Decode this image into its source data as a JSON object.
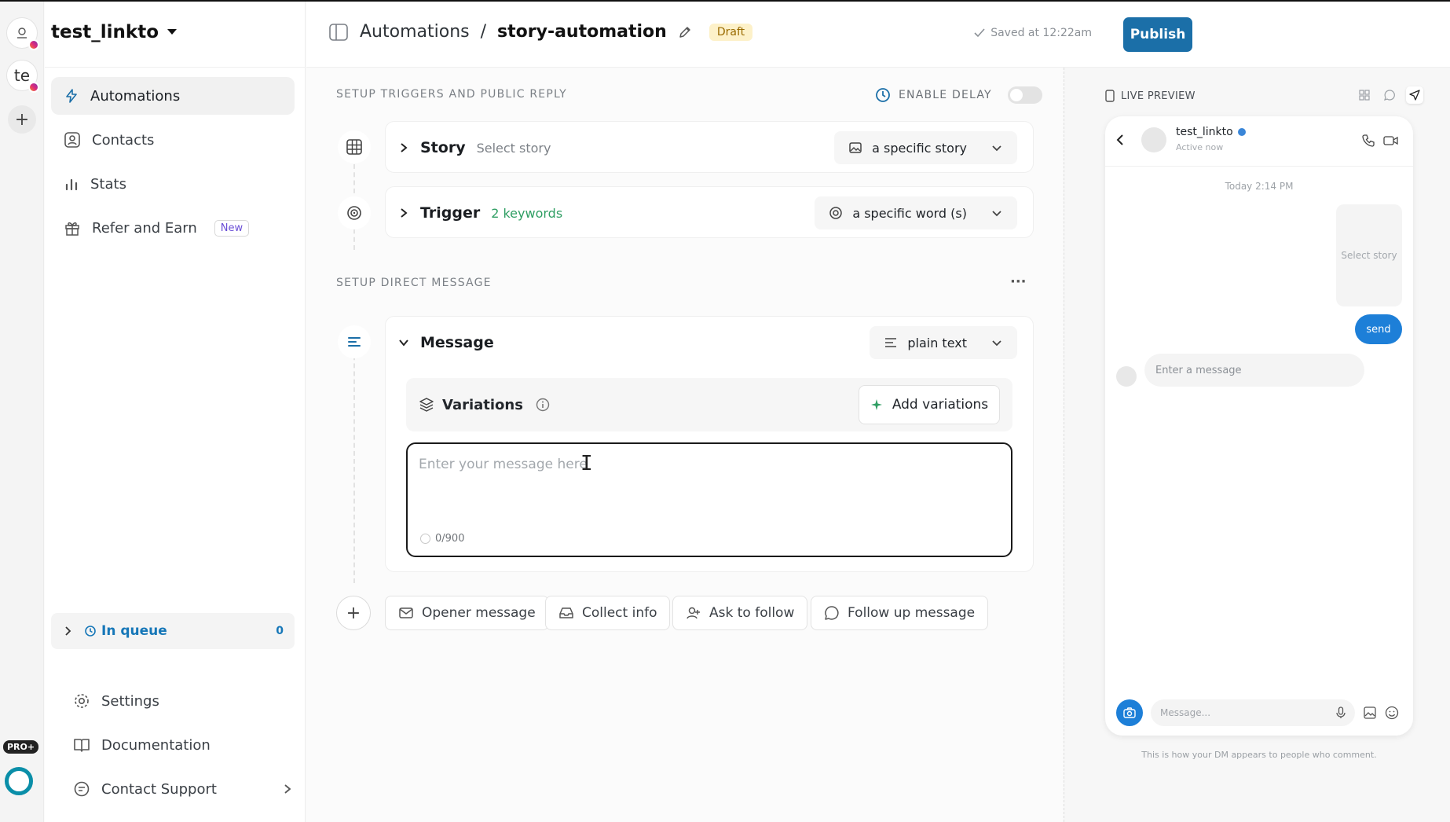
{
  "rail": {
    "account_2_label": "te",
    "add_label": "+",
    "pro_badge": "PRO+"
  },
  "sidebar": {
    "workspace": "test_linkto",
    "items": [
      {
        "label": "Automations",
        "icon": "bolt-icon"
      },
      {
        "label": "Contacts",
        "icon": "contact-card-icon"
      },
      {
        "label": "Stats",
        "icon": "bar-chart-icon"
      },
      {
        "label": "Refer and Earn",
        "icon": "gift-icon",
        "badge": "New"
      }
    ],
    "queue": {
      "label": "In queue",
      "count": "0"
    },
    "footer": [
      {
        "label": "Settings",
        "icon": "gear-icon"
      },
      {
        "label": "Documentation",
        "icon": "book-icon"
      },
      {
        "label": "Contact Support",
        "icon": "support-icon"
      }
    ]
  },
  "topbar": {
    "breadcrumb_root": "Automations",
    "separator": "/",
    "current": "story-automation",
    "status": "Draft",
    "saved": "Saved at 12:22am",
    "publish": "Publish"
  },
  "builder": {
    "section1": "SETUP TRIGGERS AND PUBLIC REPLY",
    "enable_delay": "ENABLE DELAY",
    "story": {
      "title": "Story",
      "sub": "Select story",
      "selector": "a specific story"
    },
    "trigger": {
      "title": "Trigger",
      "sub": "2 keywords",
      "selector": "a specific word (s)"
    },
    "section2": "SETUP DIRECT MESSAGE",
    "more": "···",
    "message": {
      "title": "Message",
      "selector": "plain text",
      "variations": "Variations",
      "add_variations": "Add variations",
      "placeholder": "Enter your message here",
      "counter": "0/900"
    },
    "chips": [
      "Opener message",
      "Collect info",
      "Ask to follow",
      "Follow up message"
    ]
  },
  "preview": {
    "title": "LIVE PREVIEW",
    "name": "test_linkto",
    "status": "Active now",
    "time": "Today 2:14 PM",
    "story_placeholder": "Select story",
    "send": "send",
    "incoming": "Enter a message",
    "input_placeholder": "Message...",
    "note": "This is how your DM appears to people who comment."
  },
  "colors": {
    "accent": "#1b6fa8",
    "draft_bg": "#fdf1c9",
    "keywords_green": "#2f9e63",
    "queue_blue": "#1677b8",
    "bubble_blue": "#1d7fd8"
  }
}
